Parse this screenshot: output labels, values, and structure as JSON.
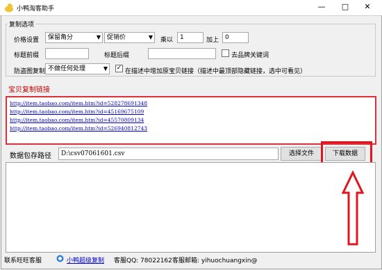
{
  "window": {
    "title": "小鸭淘客助手",
    "min": "—",
    "restore": "□",
    "close": "✕"
  },
  "copy_options": {
    "legend": "复制选项",
    "price_label": "价格设置",
    "price_mode": "保留角分",
    "promo_mode": "促销价",
    "multiply_label": "乘以",
    "multiply_value": "1",
    "add_label": "加上",
    "add_value": "0",
    "title_prefix_label": "标题前缀",
    "title_prefix_value": "",
    "title_suffix_label": "标题后缀",
    "title_suffix_value": "",
    "remove_brand_label": "去品牌关键词",
    "remove_brand_checked": false,
    "anti_theft_label": "防盗图复制",
    "anti_theft_mode": "不做任何处理",
    "add_link_checked": true,
    "add_link_label": "在描述中增加原宝贝链接（描述中最顶部隐藏链接，选中可看见）"
  },
  "links_section": {
    "title": "宝贝复制链接",
    "links": [
      "http://item.taobao.com/item.htm?id=528278691348",
      "http://item.taobao.com/item.htm?id=45169675109",
      "http://item.taobao.com/item.htm?id=45570809134",
      "http://item.taobao.com/item.htm?id=526940812743"
    ]
  },
  "save_path": {
    "label": "数据包存路径",
    "value": "D:\\csv07061601.csv",
    "choose_button": "选择文件",
    "download_button": "下载数据"
  },
  "status_bar": {
    "contact_label": "联系旺旺客服",
    "super_copy_link": "小鸭超级复制",
    "qq_text": "客服QQ: 78022162",
    "email_text": "客服邮箱: yihuochuangxin@"
  },
  "colors": {
    "highlight": "#e3141d",
    "link": "#0000cc",
    "section_title": "#c00000"
  }
}
